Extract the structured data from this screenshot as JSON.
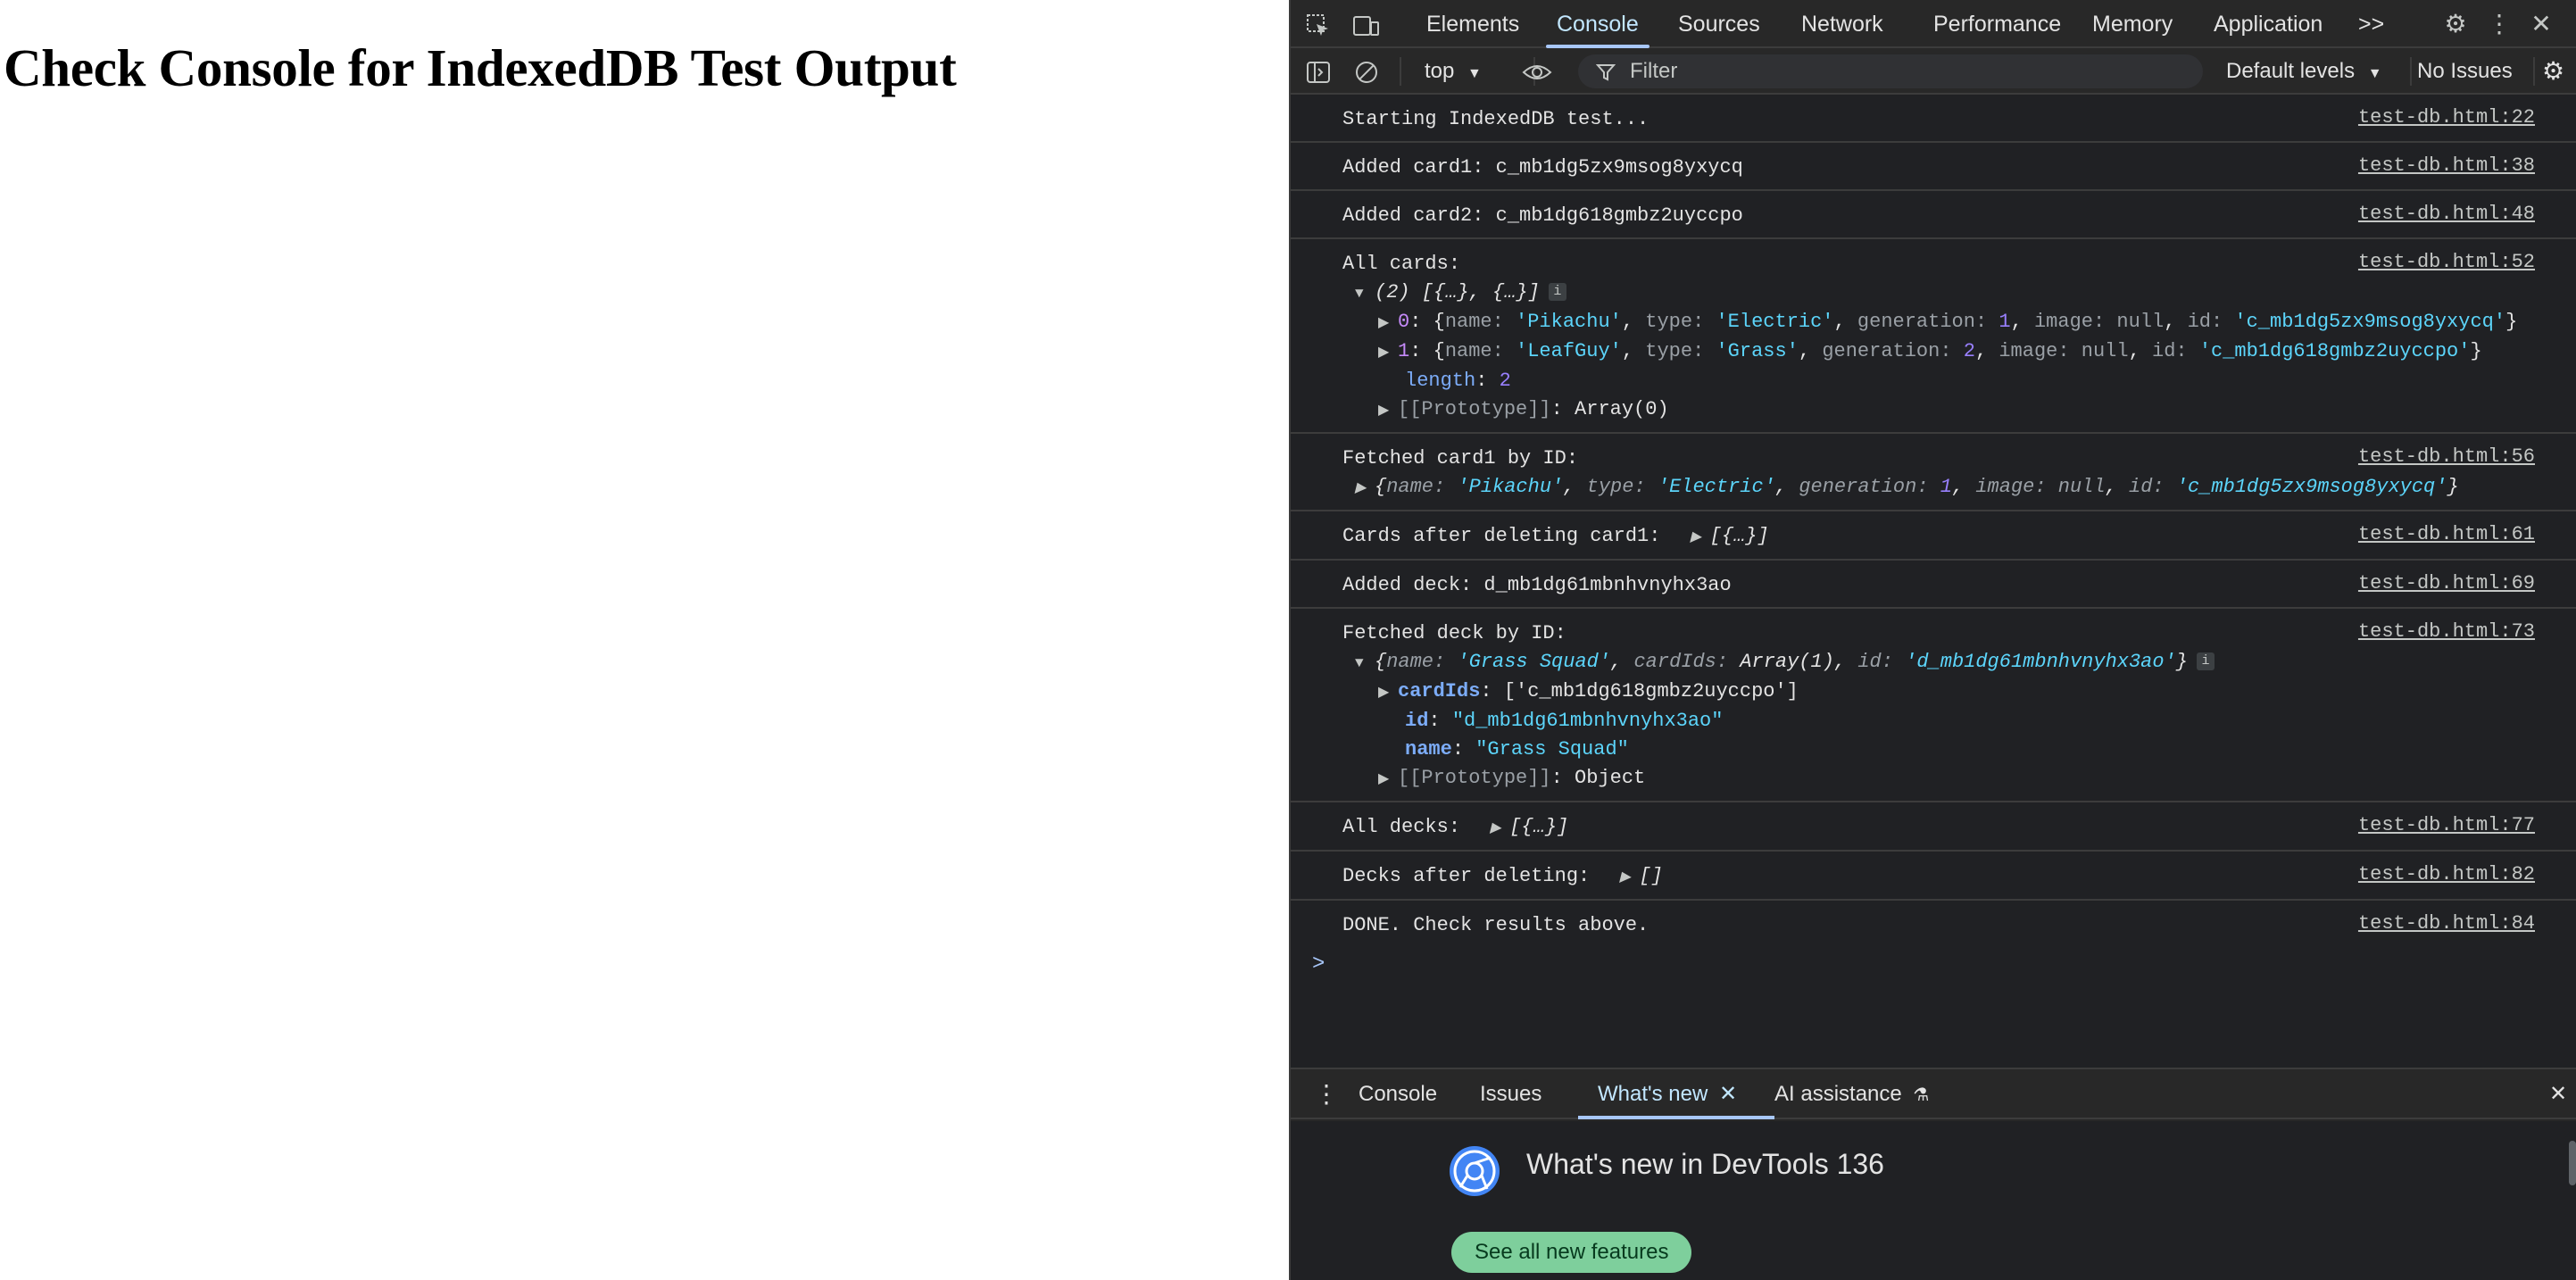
{
  "page": {
    "heading": "Check Console for IndexedDB Test Output"
  },
  "devtools": {
    "tabs": [
      "Elements",
      "Console",
      "Sources",
      "Network",
      "Performance",
      "Memory",
      "Application"
    ],
    "more_tabs": ">>",
    "toolbar": {
      "context": "top",
      "filter_placeholder": "Filter",
      "levels": "Default levels",
      "issues": "No Issues"
    },
    "console": {
      "messages": [
        {
          "text": "Starting IndexedDB test...",
          "source": "test-db.html:22"
        },
        {
          "text": "Added card1: c_mb1dg5zx9msog8yxycq",
          "source": "test-db.html:38"
        },
        {
          "text": "Added card2: c_mb1dg618gmbz2uyccpo",
          "source": "test-db.html:48"
        },
        {
          "text": "All cards:",
          "source": "test-db.html:52"
        },
        {
          "text": "Fetched card1 by ID:",
          "source": "test-db.html:56"
        },
        {
          "text": "Cards after deleting card1:",
          "source": "test-db.html:61"
        },
        {
          "text": "Added deck: d_mb1dg61mbnhvnyhx3ao",
          "source": "test-db.html:69"
        },
        {
          "text": "Fetched deck by ID:",
          "source": "test-db.html:73"
        },
        {
          "text": "All decks:",
          "source": "test-db.html:77"
        },
        {
          "text": "Decks after deleting:",
          "source": "test-db.html:82"
        },
        {
          "text": "DONE. Check results above.",
          "source": "test-db.html:84"
        }
      ],
      "all_cards": {
        "summary": "(2) [{…}, {…}]",
        "items": [
          {
            "index": "0",
            "name": "'Pikachu'",
            "type": "'Electric'",
            "generation": "1",
            "image": "null",
            "id": "'c_mb1dg5zx9msog8yxycq'"
          },
          {
            "index": "1",
            "name": "'LeafGuy'",
            "type": "'Grass'",
            "generation": "2",
            "image": "null",
            "id": "'c_mb1dg618gmbz2uyccpo'"
          }
        ],
        "length_key": "length",
        "length_value": "2",
        "proto_key": "[[Prototype]]",
        "proto_value": "Array(0)"
      },
      "fetched_card": {
        "name": "'Pikachu'",
        "type": "'Electric'",
        "generation": "1",
        "image": "null",
        "id": "'c_mb1dg5zx9msog8yxycq'"
      },
      "cards_after_delete_preview": "[{…}]",
      "fetched_deck": {
        "summary_name": "'Grass Squad'",
        "summary_cardIds": "Array(1)",
        "summary_id": "'d_mb1dg61mbnhvnyhx3ao'",
        "cardIds_value": "['c_mb1dg618gmbz2uyccpo']",
        "id_value": "\"d_mb1dg61mbnhvnyhx3ao\"",
        "name_value": "\"Grass Squad\"",
        "proto_key": "[[Prototype]]",
        "proto_value": "Object"
      },
      "all_decks_preview": "[{…}]",
      "decks_after_delete_preview": "[]",
      "prompt": ">"
    },
    "drawer": {
      "tabs": [
        "Console",
        "Issues",
        "What's new",
        "AI assistance"
      ],
      "whats_new_title": "What's new in DevTools 136",
      "see_all_button": "See all new features"
    }
  }
}
